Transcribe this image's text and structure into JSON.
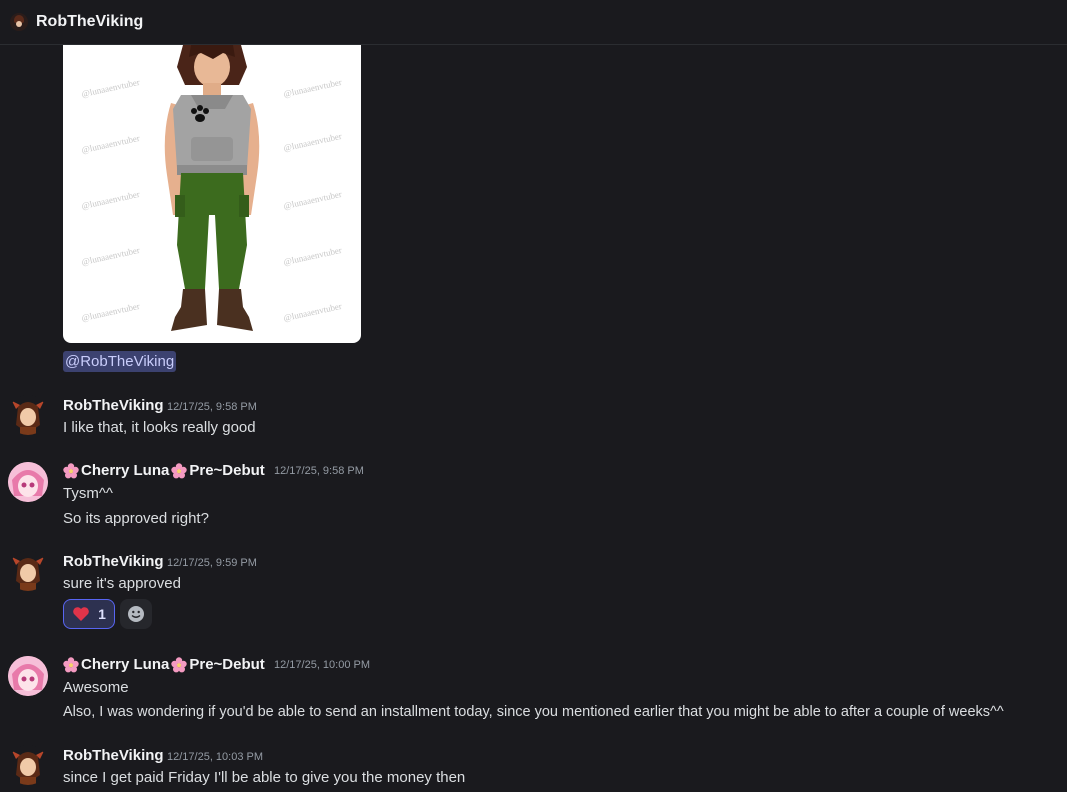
{
  "header": {
    "title": "RobTheViking"
  },
  "attachment": {
    "watermark_text": "@lunaaenvtuber"
  },
  "mention": {
    "text": "@RobTheViking"
  },
  "messages": [
    {
      "author": "RobTheViking",
      "timestamp": "12/17/25, 9:58 PM",
      "lines": [
        "I like that, it looks really good"
      ]
    },
    {
      "author_name": "Cherry Luna",
      "author_tag": "Pre~Debut",
      "timestamp": "12/17/25, 9:58 PM",
      "lines": [
        "Tysm^^",
        "So its approved right?"
      ]
    },
    {
      "author": "RobTheViking",
      "timestamp": "12/17/25, 9:59 PM",
      "lines": [
        "sure it's approved"
      ],
      "reaction": {
        "emoji": "heart",
        "count": "1"
      }
    },
    {
      "author_name": "Cherry Luna",
      "author_tag": "Pre~Debut",
      "timestamp": "12/17/25, 10:00 PM",
      "lines": [
        "Awesome",
        "Also, I was wondering if you'd be able to send an installment today, since you mentioned earlier that you might be able to after a couple of weeks^^"
      ]
    },
    {
      "author": "RobTheViking",
      "timestamp": "12/17/25, 10:03 PM",
      "lines": [
        "since I get paid Friday I'll be able to give you the money then"
      ]
    }
  ],
  "colors": {
    "background": "#1a1a1e",
    "mention_bg": "#3c4270",
    "reaction_border": "#5865f2",
    "heart": "#e0344a",
    "flower": "#f49ac1"
  }
}
